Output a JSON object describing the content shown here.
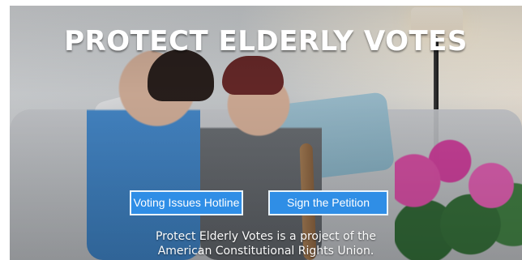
{
  "hero": {
    "title": "PROTECT ELDERLY VOTES",
    "buttons": {
      "hotline_label": "Voting Issues Hotline",
      "petition_label": "Sign the Petition"
    },
    "footer": {
      "line1": "Protect Elderly Votes is a project of the",
      "line2": "American Constitutional Rights Union."
    }
  },
  "colors": {
    "button_blue": "#2f8ee6",
    "button_border": "#ffffff",
    "title_text": "#ffffff"
  }
}
